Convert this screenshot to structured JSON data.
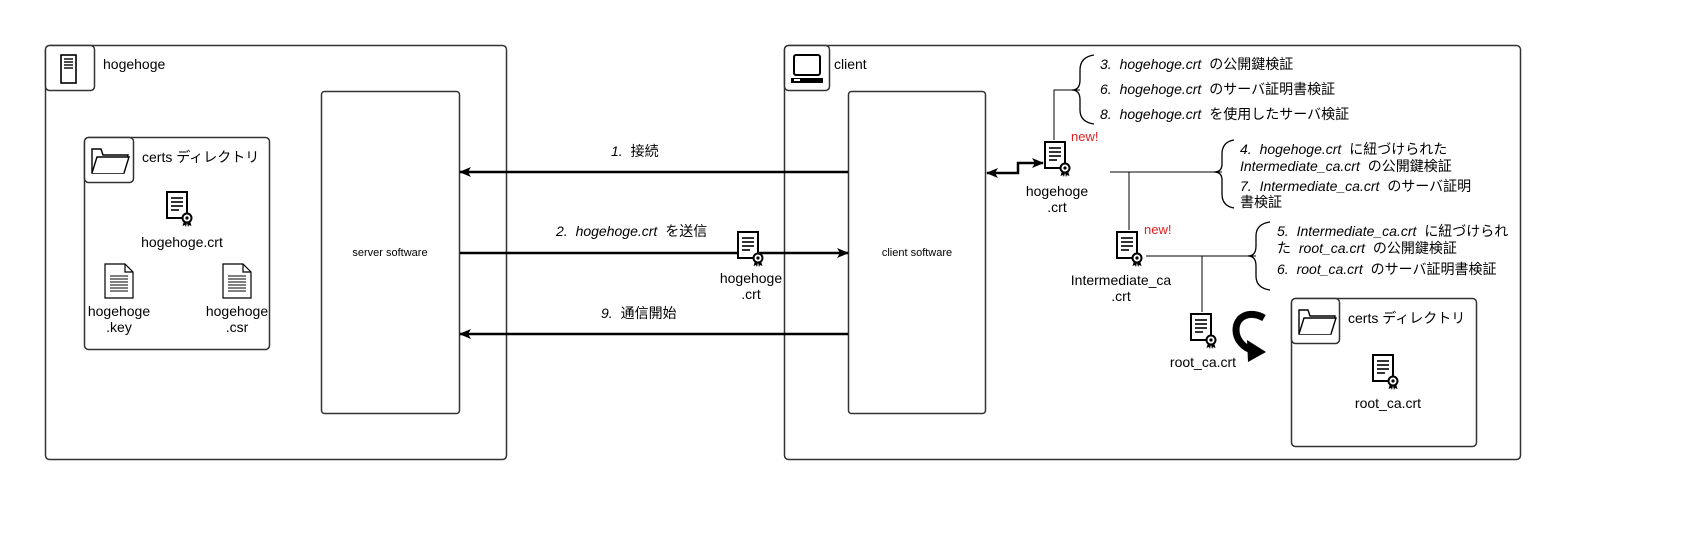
{
  "server": {
    "title": "hogehoge",
    "software": "server software",
    "certs_dir": "certs ディレクトリ",
    "files": {
      "crt": "hogehoge.crt",
      "key_line1": "hogehoge",
      "key_line2": ".key",
      "csr_line1": "hogehoge",
      "csr_line2": ".csr"
    }
  },
  "client": {
    "title": "client",
    "software": "client software",
    "certs_dir": "certs ディレクトリ",
    "root_file": "root_ca.crt"
  },
  "messages": {
    "m1_num": "1.",
    "m1_text": "接続",
    "m2_num": "2.",
    "m2_file": "hogehoge.crt",
    "m2_text": "を送信",
    "m9_num": "9.",
    "m9_text": "通信開始",
    "sent_cert_line1": "hogehoge",
    "sent_cert_line2": ".crt"
  },
  "chain": {
    "leaf_line1": "hogehoge",
    "leaf_line2": ".crt",
    "inter_line1": "Intermediate_ca",
    "inter_line2": ".crt",
    "root": "root_ca.crt",
    "new1": "new!",
    "new2": "new!"
  },
  "steps": {
    "s3": {
      "num": "3.",
      "file": "hogehoge.crt",
      "text": "の公開鍵検証"
    },
    "s6": {
      "num": "6.",
      "file": "hogehoge.crt",
      "text": "のサーバ証明書検証"
    },
    "s8": {
      "num": "8.",
      "file": "hogehoge.crt",
      "text": "を使用したサーバ検証"
    },
    "s4": {
      "num": "4.",
      "file": "hogehoge.crt",
      "text": "に紐づけられた",
      "file2": "Intermediate_ca.crt",
      "text2": "の公開鍵検証"
    },
    "s7": {
      "num": "7.",
      "file": "Intermediate_ca.crt",
      "text": "のサーバ証明",
      "text2": "書検証"
    },
    "s5": {
      "num": "5.",
      "file": "Intermediate_ca.crt",
      "text": "に紐づけられ",
      "pre2": "た",
      "file2": "root_ca.crt",
      "text2": "の公開鍵検証"
    },
    "s6b": {
      "num": "6.",
      "file": "root_ca.crt",
      "text": "のサーバ証明書検証"
    }
  },
  "icons": {
    "server_icon": "server-icon",
    "monitor_icon": "monitor-icon",
    "folder_icon": "folder-icon",
    "certificate_icon": "certificate-icon",
    "document_icon": "document-icon",
    "curved_arrow_icon": "curved-arrow-icon"
  },
  "colors": {
    "border": "#333333",
    "accent_new": "#e02020",
    "line": "#000000"
  }
}
